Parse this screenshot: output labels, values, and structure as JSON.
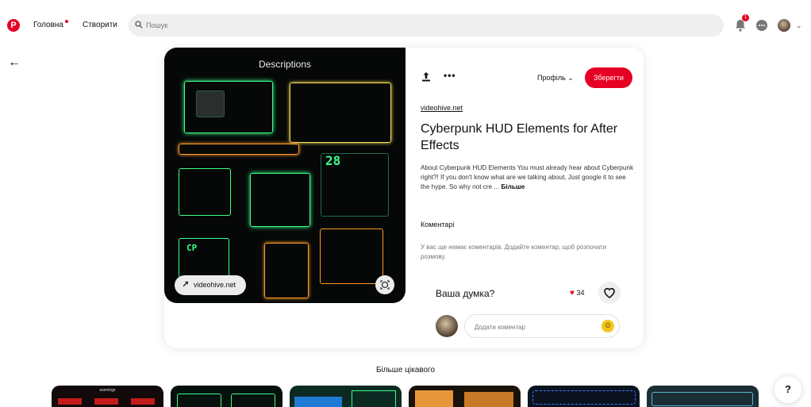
{
  "header": {
    "nav_home": "Головна",
    "nav_create": "Створити",
    "search_placeholder": "Пошук",
    "notification_count": "1"
  },
  "pin": {
    "image_title": "Descriptions",
    "image_counter": "28",
    "image_cp_label": "CP",
    "source_pill": "videohive.net",
    "profile_dropdown": "Профіль",
    "save_label": "Зберегти",
    "domain": "videohive.net",
    "title": "Cyberpunk HUD Elements for After Effects",
    "description": "About Cyberpunk HUD Elements You must already hear about Cyberpunk right?! If you don't know what are we talking about, Just google it to see the hype. So why not cre ...",
    "description_more": "Більше",
    "comments_heading": "Коментарі",
    "no_comments_text": "У вас ще немає коментарів. Додайте коментар, щоб розпочати розмову.",
    "opinion_label": "Ваша думка?",
    "reaction_count": "34",
    "comment_placeholder": "Додати коментар"
  },
  "more_section": {
    "title": "Більше цікавого",
    "thumb_label": "warnings",
    "thumbs": [
      "#120a0a",
      "#06100d",
      "#0b2a22",
      "#1a1208",
      "#0a1220",
      "#1c2e35"
    ]
  },
  "help_label": "?",
  "colors": {
    "brand": "#e60023",
    "hud_green": "#3cff8a",
    "hud_orange": "#ff9a2a",
    "hud_yellow": "#f6e15a"
  }
}
